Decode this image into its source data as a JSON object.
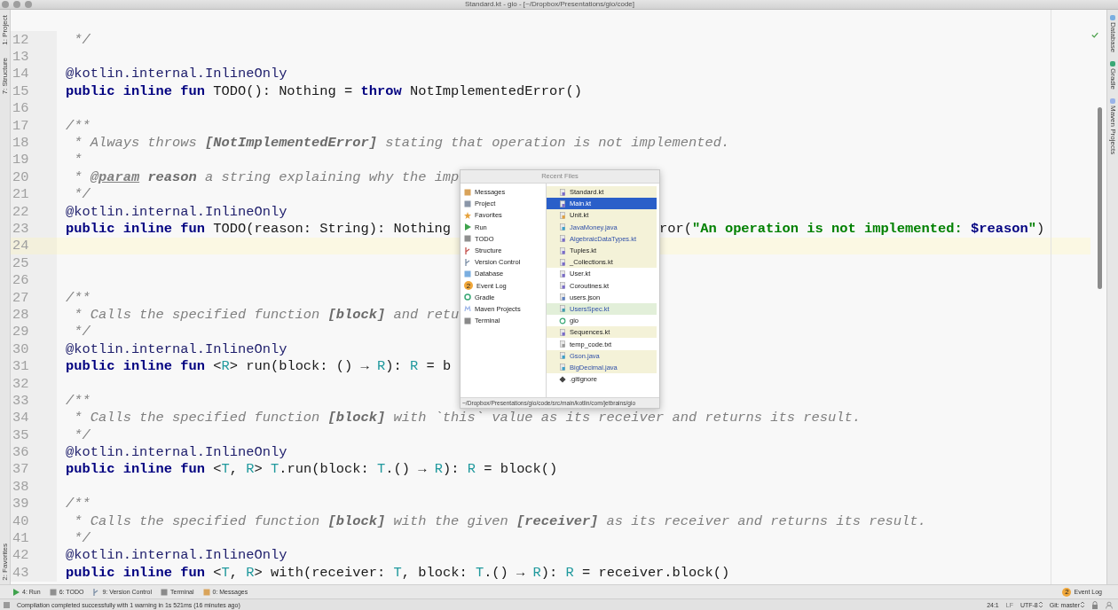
{
  "window": {
    "title": "Standard.kt - gio - [~/Dropbox/Presentations/gio/code]"
  },
  "left_tool_strip": [
    {
      "label": "1: Project"
    },
    {
      "label": "7: Structure"
    },
    {
      "label": "2: Favorites"
    }
  ],
  "right_tool_strip": [
    {
      "kind": "database",
      "label": "Database"
    },
    {
      "kind": "gradle",
      "label": "Gradle"
    },
    {
      "kind": "maven",
      "label": "Maven Projects"
    }
  ],
  "editor": {
    "lines": [
      {
        "number": "12",
        "highlighted": false,
        "segments": [
          {
            "kind": "comment",
            "text": " */"
          }
        ]
      },
      {
        "number": "13",
        "highlighted": false
      },
      {
        "number": "14",
        "highlighted": false,
        "segments": [
          {
            "kind": "annotation",
            "text": "@kotlin.internal.InlineOnly"
          }
        ]
      },
      {
        "number": "15",
        "highlighted": false,
        "segments": [
          {
            "kind": "keyword",
            "text": "public inline fun"
          },
          {
            "kind": "plain",
            "text": " TODO(): Nothing = "
          },
          {
            "kind": "keyword",
            "text": "throw"
          },
          {
            "kind": "plain",
            "text": " NotImplementedError()"
          }
        ]
      },
      {
        "number": "16",
        "highlighted": false
      },
      {
        "number": "17",
        "highlighted": false,
        "segments": [
          {
            "kind": "comment",
            "text": "/**"
          }
        ]
      },
      {
        "number": "18",
        "highlighted": false,
        "segments": [
          {
            "kind": "comment",
            "text": " * Always throws "
          },
          {
            "kind": "doc-bold",
            "text": "[NotImplementedError]"
          },
          {
            "kind": "comment",
            "text": " stating that operation is not implemented."
          }
        ]
      },
      {
        "number": "19",
        "highlighted": false,
        "segments": [
          {
            "kind": "comment",
            "text": " *"
          }
        ]
      },
      {
        "number": "20",
        "highlighted": false,
        "segments": [
          {
            "kind": "comment",
            "text": " * "
          },
          {
            "kind": "doc-tag",
            "text": "@param"
          },
          {
            "kind": "doc-bold",
            "text": " reason"
          },
          {
            "kind": "comment",
            "text": " a string explaining why the imp"
          }
        ]
      },
      {
        "number": "21",
        "highlighted": false,
        "segments": [
          {
            "kind": "comment",
            "text": " */"
          }
        ]
      },
      {
        "number": "22",
        "highlighted": false,
        "segments": [
          {
            "kind": "annotation",
            "text": "@kotlin.internal.InlineOnly"
          }
        ]
      },
      {
        "number": "23",
        "highlighted": false,
        "segments": [
          {
            "kind": "keyword",
            "text": "public inline fun"
          },
          {
            "kind": "plain",
            "text": " TODO(reason: String): Nothing"
          }
        ],
        "after_popup": [
          {
            "kind": "plain",
            "text": "ror("
          },
          {
            "kind": "string",
            "text": "\"An operation is not implemented: "
          },
          {
            "kind": "string-var",
            "text": "$reason"
          },
          {
            "kind": "string",
            "text": "\""
          },
          {
            "kind": "plain",
            "text": ")"
          }
        ]
      },
      {
        "number": "24",
        "highlighted": true
      },
      {
        "number": "25",
        "highlighted": false
      },
      {
        "number": "26",
        "highlighted": false
      },
      {
        "number": "27",
        "highlighted": false,
        "segments": [
          {
            "kind": "comment",
            "text": "/**"
          }
        ]
      },
      {
        "number": "28",
        "highlighted": false,
        "segments": [
          {
            "kind": "comment",
            "text": " * Calls the specified function "
          },
          {
            "kind": "doc-bold",
            "text": "[block]"
          },
          {
            "kind": "comment",
            "text": " and retu"
          }
        ]
      },
      {
        "number": "29",
        "highlighted": false,
        "segments": [
          {
            "kind": "comment",
            "text": " */"
          }
        ]
      },
      {
        "number": "30",
        "highlighted": false,
        "segments": [
          {
            "kind": "annotation",
            "text": "@kotlin.internal.InlineOnly"
          }
        ]
      },
      {
        "number": "31",
        "highlighted": false,
        "segments": [
          {
            "kind": "keyword",
            "text": "public inline fun"
          },
          {
            "kind": "plain",
            "text": " <"
          },
          {
            "kind": "type-param",
            "text": "R"
          },
          {
            "kind": "plain",
            "text": "> run(block: () → "
          },
          {
            "kind": "type-param",
            "text": "R"
          },
          {
            "kind": "plain",
            "text": "): "
          },
          {
            "kind": "type-param",
            "text": "R"
          },
          {
            "kind": "plain",
            "text": " = b"
          }
        ]
      },
      {
        "number": "32",
        "highlighted": false
      },
      {
        "number": "33",
        "highlighted": false,
        "segments": [
          {
            "kind": "comment",
            "text": "/**"
          }
        ]
      },
      {
        "number": "34",
        "highlighted": false,
        "segments": [
          {
            "kind": "comment",
            "text": " * Calls the specified function "
          },
          {
            "kind": "doc-bold",
            "text": "[block]"
          },
          {
            "kind": "comment",
            "text": " with `this` value as its receiver and returns its result."
          }
        ]
      },
      {
        "number": "35",
        "highlighted": false,
        "segments": [
          {
            "kind": "comment",
            "text": " */"
          }
        ]
      },
      {
        "number": "36",
        "highlighted": false,
        "segments": [
          {
            "kind": "annotation",
            "text": "@kotlin.internal.InlineOnly"
          }
        ]
      },
      {
        "number": "37",
        "highlighted": false,
        "segments": [
          {
            "kind": "keyword",
            "text": "public inline fun"
          },
          {
            "kind": "plain",
            "text": " <"
          },
          {
            "kind": "type-param",
            "text": "T"
          },
          {
            "kind": "plain",
            "text": ", "
          },
          {
            "kind": "type-param",
            "text": "R"
          },
          {
            "kind": "plain",
            "text": "> "
          },
          {
            "kind": "type-param",
            "text": "T"
          },
          {
            "kind": "plain",
            "text": ".run(block: "
          },
          {
            "kind": "type-param",
            "text": "T"
          },
          {
            "kind": "plain",
            "text": ".() → "
          },
          {
            "kind": "type-param",
            "text": "R"
          },
          {
            "kind": "plain",
            "text": "): "
          },
          {
            "kind": "type-param",
            "text": "R"
          },
          {
            "kind": "plain",
            "text": " = block()"
          }
        ]
      },
      {
        "number": "38",
        "highlighted": false
      },
      {
        "number": "39",
        "highlighted": false,
        "segments": [
          {
            "kind": "comment",
            "text": "/**"
          }
        ]
      },
      {
        "number": "40",
        "highlighted": false,
        "segments": [
          {
            "kind": "comment",
            "text": " * Calls the specified function "
          },
          {
            "kind": "doc-bold",
            "text": "[block]"
          },
          {
            "kind": "comment",
            "text": " with the given "
          },
          {
            "kind": "doc-bold",
            "text": "[receiver]"
          },
          {
            "kind": "comment",
            "text": " as its receiver and returns its result."
          }
        ]
      },
      {
        "number": "41",
        "highlighted": false,
        "segments": [
          {
            "kind": "comment",
            "text": " */"
          }
        ]
      },
      {
        "number": "42",
        "highlighted": false,
        "segments": [
          {
            "kind": "annotation",
            "text": "@kotlin.internal.InlineOnly"
          }
        ]
      },
      {
        "number": "43",
        "highlighted": false,
        "segments": [
          {
            "kind": "keyword",
            "text": "public inline fun"
          },
          {
            "kind": "plain",
            "text": " <"
          },
          {
            "kind": "type-param",
            "text": "T"
          },
          {
            "kind": "plain",
            "text": ", "
          },
          {
            "kind": "type-param",
            "text": "R"
          },
          {
            "kind": "plain",
            "text": "> with(receiver: "
          },
          {
            "kind": "type-param",
            "text": "T"
          },
          {
            "kind": "plain",
            "text": ", block: "
          },
          {
            "kind": "type-param",
            "text": "T"
          },
          {
            "kind": "plain",
            "text": ".() → "
          },
          {
            "kind": "type-param",
            "text": "R"
          },
          {
            "kind": "plain",
            "text": "): "
          },
          {
            "kind": "type-param",
            "text": "R"
          },
          {
            "kind": "plain",
            "text": " = receiver.block()"
          }
        ]
      }
    ]
  },
  "recent_files": {
    "title": "Recent Files",
    "tool_windows": [
      {
        "kind": "messages",
        "label": "Messages"
      },
      {
        "kind": "project",
        "label": "Project"
      },
      {
        "kind": "favorites",
        "label": "Favorites"
      },
      {
        "kind": "run",
        "label": "Run"
      },
      {
        "kind": "todo",
        "label": "TODO"
      },
      {
        "kind": "structure",
        "label": "Structure"
      },
      {
        "kind": "vcs",
        "label": "Version Control"
      },
      {
        "kind": "database",
        "label": "Database"
      },
      {
        "kind": "eventlog",
        "label": "Event Log",
        "badge": "2"
      },
      {
        "kind": "gradle",
        "label": "Gradle"
      },
      {
        "kind": "maven",
        "label": "Maven Projects"
      },
      {
        "kind": "terminal",
        "label": "Terminal"
      }
    ],
    "files": [
      {
        "kind": "kotlin",
        "name": "Standard.kt",
        "selected": false,
        "changed": false,
        "color": "#f4f2d8"
      },
      {
        "kind": "kotlin",
        "name": "Main.kt",
        "selected": true,
        "changed": false
      },
      {
        "kind": "kotlin-object",
        "name": "Unit.kt",
        "selected": false,
        "changed": false,
        "color": "#f4f2d8"
      },
      {
        "kind": "java",
        "name": "JavaMoney.java",
        "selected": false,
        "changed": true,
        "color": "#f4f2d8"
      },
      {
        "kind": "kotlin",
        "name": "AlgebraicDataTypes.kt",
        "selected": false,
        "changed": true,
        "color": "#f4f2d8"
      },
      {
        "kind": "kotlin",
        "name": "Tuples.kt",
        "selected": false,
        "changed": false,
        "color": "#f4f2d8"
      },
      {
        "kind": "kotlin",
        "name": "_Collections.kt",
        "selected": false,
        "changed": false,
        "color": "#f4f2d8"
      },
      {
        "kind": "kotlin",
        "name": "User.kt",
        "selected": false,
        "changed": false,
        "color": "#ffffff"
      },
      {
        "kind": "kotlin",
        "name": "Coroutines.kt",
        "selected": false,
        "changed": false,
        "color": "#ffffff"
      },
      {
        "kind": "json",
        "name": "users.json",
        "selected": false,
        "changed": false,
        "color": "#ffffff"
      },
      {
        "kind": "kotlin-class",
        "name": "UsersSpec.kt",
        "selected": false,
        "changed": true,
        "color": "#e2efd9"
      },
      {
        "kind": "module",
        "name": "gio",
        "selected": false,
        "changed": false,
        "color": "#ffffff"
      },
      {
        "kind": "kotlin",
        "name": "Sequences.kt",
        "selected": false,
        "changed": false,
        "color": "#f4f2d8"
      },
      {
        "kind": "text",
        "name": "temp_code.txt",
        "selected": false,
        "changed": false,
        "color": "#ffffff"
      },
      {
        "kind": "java",
        "name": "Gson.java",
        "selected": false,
        "changed": true,
        "color": "#f4f2d8"
      },
      {
        "kind": "java",
        "name": "BigDecimal.java",
        "selected": false,
        "changed": true,
        "color": "#f4f2d8"
      },
      {
        "kind": "git",
        "name": ".gitignore",
        "selected": false,
        "changed": false,
        "color": "#ffffff"
      }
    ],
    "path": "~/Dropbox/Presentations/gio/code/src/main/kotlin/com/jetbrains/gio"
  },
  "tool_bar": [
    {
      "kind": "run",
      "label": "4: Run"
    },
    {
      "kind": "todo",
      "label": "6: TODO"
    },
    {
      "kind": "vcs",
      "label": "9: Version Control"
    },
    {
      "kind": "terminal",
      "label": "Terminal"
    },
    {
      "kind": "messages",
      "label": "0: Messages"
    }
  ],
  "event_log": {
    "badge": "2",
    "label": "Event Log"
  },
  "status_bar": {
    "message": "Compilation completed successfully with 1 warning in 1s 521ms (16 minutes ago)",
    "position": "24:1",
    "line_separator": "LF",
    "encoding": "UTF-8",
    "branch": "Git: master"
  }
}
